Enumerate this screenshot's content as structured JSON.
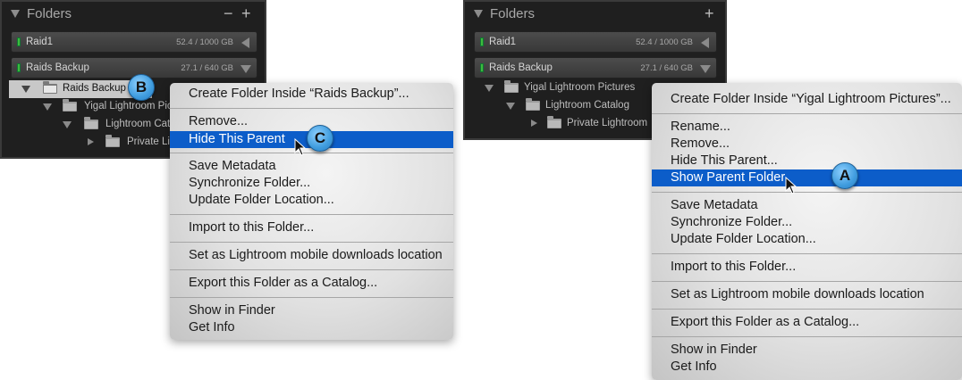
{
  "left": {
    "panel": {
      "title": "Folders",
      "minus_icon": "minus",
      "plus_icon": "+",
      "volumes": [
        {
          "name": "Raid1",
          "size": "52.4 / 1000 GB"
        },
        {
          "name": "Raids Backup",
          "size": "27.1 / 640 GB"
        }
      ],
      "tree": [
        {
          "label": "Raids Backup"
        },
        {
          "label": "Yigal Lightroom Pic"
        },
        {
          "label": "Lightroom Cata"
        },
        {
          "label": "Private Lig"
        }
      ]
    },
    "menu": {
      "create": "Create Folder Inside “Raids Backup”...",
      "remove": "Remove...",
      "hide_parent": "Hide This Parent",
      "save_metadata": "Save Metadata",
      "synchronize": "Synchronize Folder...",
      "update_location": "Update Folder Location...",
      "import": "Import to this Folder...",
      "mobile": "Set as Lightroom mobile downloads location",
      "export": "Export this Folder as a Catalog...",
      "show_finder": "Show in Finder",
      "get_info": "Get Info"
    },
    "callouts": {
      "b": "B",
      "c": "C"
    }
  },
  "right": {
    "panel": {
      "title": "Folders",
      "plus_icon": "+",
      "volumes": [
        {
          "name": "Raid1",
          "size": "52.4 / 1000 GB"
        },
        {
          "name": "Raids Backup",
          "size": "27.1 / 640 GB"
        }
      ],
      "tree": [
        {
          "label": "Yigal Lightroom Pictures"
        },
        {
          "label": "Lightroom Catalog"
        },
        {
          "label": "Private Lightroom"
        }
      ]
    },
    "menu": {
      "create": "Create Folder Inside “Yigal Lightroom Pictures”...",
      "rename": "Rename...",
      "remove": "Remove...",
      "hide_parent": "Hide This Parent...",
      "show_parent": "Show Parent Folder",
      "save_metadata": "Save Metadata",
      "synchronize": "Synchronize Folder...",
      "update_location": "Update Folder Location...",
      "import": "Import to this Folder...",
      "mobile": "Set as Lightroom mobile downloads location",
      "export": "Export this Folder as a Catalog...",
      "show_finder": "Show in Finder",
      "get_info": "Get Info"
    },
    "callouts": {
      "a": "A"
    }
  },
  "colors": {
    "panel_bg": "#1f1f1f",
    "menu_highlight": "#0c5dc9",
    "callout_blue": "#3f9cde",
    "volume_led": "#3dbb3d"
  }
}
